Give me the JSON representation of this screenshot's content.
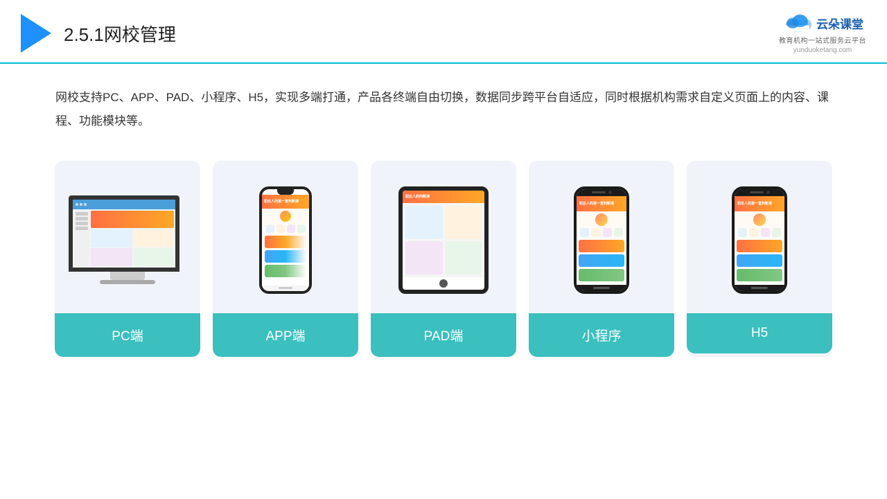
{
  "header": {
    "title_prefix": "2.5.1",
    "title_main": "网校管理",
    "brand": {
      "name": "云朵课堂",
      "tagline": "教育机构一站\n式服务云平台",
      "url": "yunduoketang.com"
    }
  },
  "description": {
    "text": "网校支持PC、APP、PAD、小程序、H5，实现多端打通，产品各终端自由切换，数据同步跨平台自适应，同时根据机构需求自定义页面上的内容、课程、功能模块等。"
  },
  "cards": [
    {
      "id": "pc",
      "label": "PC端"
    },
    {
      "id": "app",
      "label": "APP端"
    },
    {
      "id": "pad",
      "label": "PAD端"
    },
    {
      "id": "miniapp",
      "label": "小程序"
    },
    {
      "id": "h5",
      "label": "H5"
    }
  ],
  "colors": {
    "accent": "#3bbfbf",
    "border": "#00bcd4",
    "card_bg": "#f0f4fa",
    "title": "#222222"
  }
}
